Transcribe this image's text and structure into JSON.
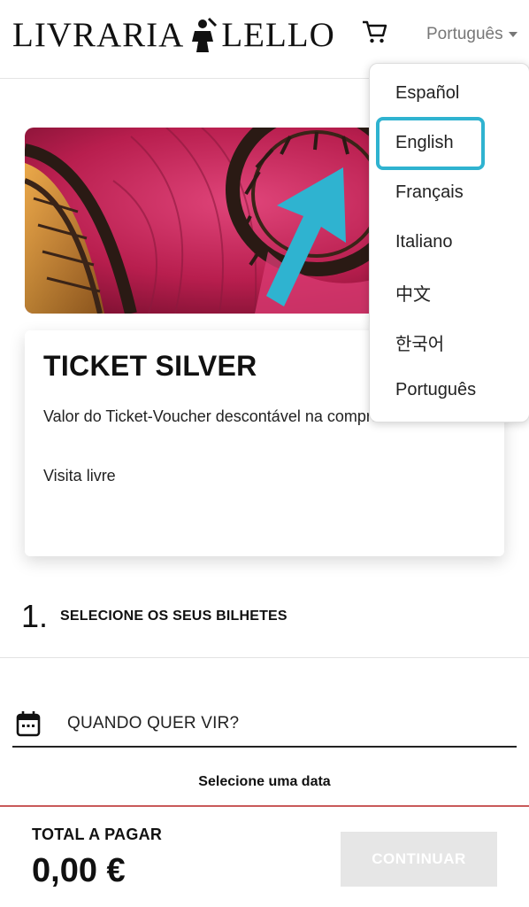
{
  "header": {
    "logo_left": "LIVRARIA",
    "logo_right": "LELLO",
    "language_current": "Português"
  },
  "language_menu": {
    "items": [
      "Español",
      "English",
      "Français",
      "Italiano",
      "中文",
      "한국어",
      "Português"
    ],
    "highlighted": "English",
    "highlight_color": "#2fb3d0"
  },
  "product": {
    "title": "TICKET SILVER",
    "description": "Valor do Ticket-Voucher descontável na compra de um livro",
    "note": "Visita livre"
  },
  "step": {
    "number": "1.",
    "label": "SELECIONE OS SEUS BILHETES"
  },
  "date": {
    "placeholder": "QUANDO QUER VIR?",
    "hint": "Selecione uma data"
  },
  "footer": {
    "total_label": "TOTAL A PAGAR",
    "total_value": "0,00 €",
    "continue_label": "CONTINUAR"
  },
  "icons": {
    "cart": "cart-icon",
    "calendar": "calendar-icon",
    "caret": "caret-down-icon",
    "arrow": "arrow-pointer-icon"
  },
  "colors": {
    "accent": "#2fb3d0",
    "hero_red": "#c4255a",
    "divider_red": "#c95a5a"
  }
}
